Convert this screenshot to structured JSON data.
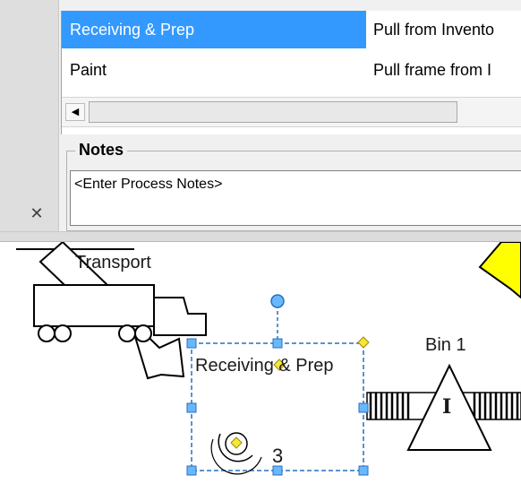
{
  "process_table": {
    "rows": [
      {
        "name": "Receiving & Prep",
        "description": "Pull from Invento",
        "selected": true
      },
      {
        "name": "Paint",
        "description": "Pull frame from I",
        "selected": false
      }
    ]
  },
  "scrollbar": {
    "left_arrow_icon": "arrow-left-icon"
  },
  "notes": {
    "legend": "Notes",
    "placeholder": "<Enter Process Notes>"
  },
  "panel": {
    "close_icon": "close-icon",
    "close_glyph": "✕"
  },
  "canvas": {
    "transport_label": "Transport",
    "process_box_label": "Receiving & Prep",
    "operator_count": "3",
    "inventory_label": "Bin 1",
    "inventory_symbol": "I"
  },
  "colors": {
    "selection": "#3399ff",
    "handle_fill": "#68b8ff",
    "handle_stroke": "#2a6ebd",
    "control_yellow": "#f5e63a",
    "shape_stroke": "#000000"
  }
}
